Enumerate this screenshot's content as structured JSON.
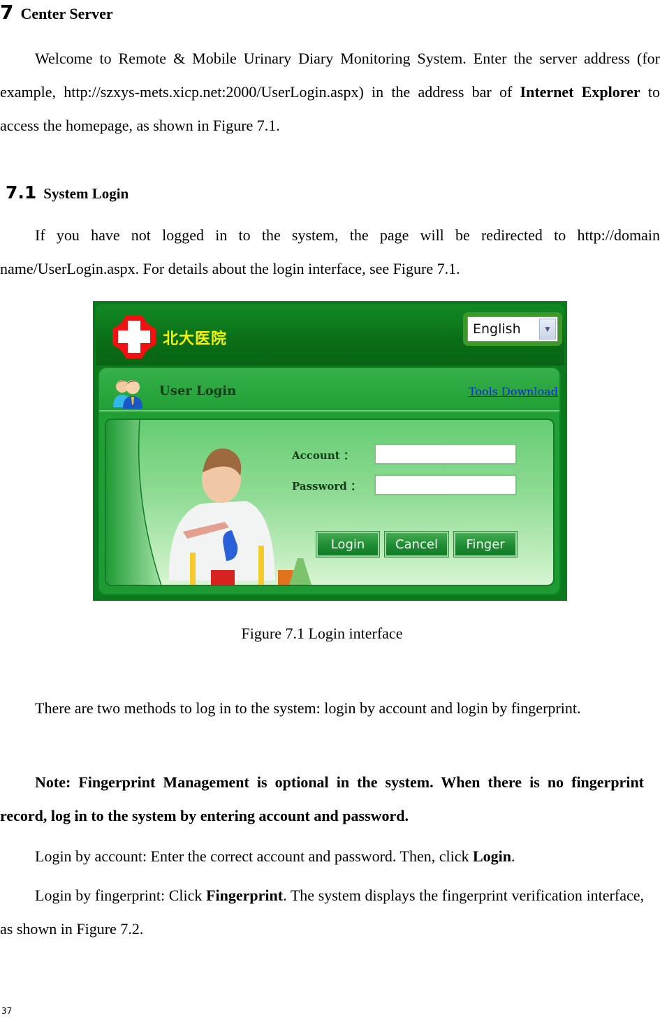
{
  "heading1": {
    "number": "7",
    "title": "Center Server"
  },
  "intro": {
    "text_before": "Welcome to Remote & Mobile Urinary Diary Monitoring System. Enter the server address (for example, http://szxys-mets.xicp.net:2000/UserLogin.aspx) in the address bar of ",
    "bold": "Internet Explorer",
    "text_after": " to access the homepage, as shown in Figure 7.1."
  },
  "heading2": {
    "number": "7.1",
    "title": "System Login"
  },
  "redirect_paragraph": "If you have not logged in to the system, the page will be redirected to http://domain name/UserLogin.aspx. For details about the login interface, see Figure 7.1.",
  "figure": {
    "hospital_name": "北大医院",
    "language_select": {
      "selected": "English"
    },
    "panel_title": "User Login",
    "tools_download": "Tools Download",
    "account_label": "Account ：",
    "password_label": "Password ：",
    "account_value": "",
    "password_value": "",
    "buttons": {
      "login": "Login",
      "cancel": "Cancel",
      "finger": "Finger"
    },
    "colors": {
      "frame": "#0b7a1d",
      "panel": "#22a036",
      "inner_top": "#66cd73",
      "inner_bottom": "#d7f5d1",
      "logo_text": "#f7f000",
      "link": "#1128d6"
    }
  },
  "caption": "Figure 7.1 Login interface",
  "methods_paragraph": "There are two methods to log in to the system: login by account and login by fingerprint.",
  "note_paragraph": "Note: Fingerprint Management is optional in the system. When there is no fingerprint record, log in to the system by entering account and password.",
  "account_login": {
    "text_before": "Login by account: Enter the correct account and password. Then, click ",
    "bold": "Login",
    "text_after": "."
  },
  "finger_login": {
    "text_before": "Login by fingerprint: Click ",
    "bold": "Fingerprint",
    "text_after": ". The system displays the fingerprint verification interface, as shown in Figure 7.2."
  },
  "page_number": "37"
}
